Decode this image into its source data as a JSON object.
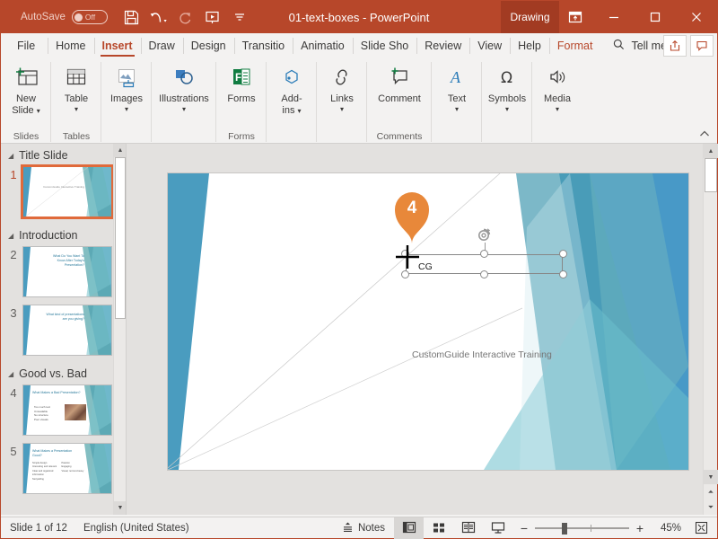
{
  "titlebar": {
    "autosave_label": "AutoSave",
    "autosave_state": "Off",
    "quick_access": [
      {
        "name": "save-icon",
        "tooltip": "Save"
      },
      {
        "name": "undo-icon",
        "tooltip": "Undo"
      },
      {
        "name": "redo-icon",
        "tooltip": "Redo"
      },
      {
        "name": "start-presentation-icon",
        "tooltip": "Start From Beginning"
      },
      {
        "name": "customize-qat-icon",
        "tooltip": "Customize Quick Access Toolbar"
      }
    ],
    "document_title": "01-text-boxes  -  PowerPoint",
    "contextual_tab": "Drawing",
    "ribbon_display_options": "ribbon-display-options-icon",
    "minimize": "minimize-icon",
    "maximize": "maximize-icon",
    "close": "close-icon"
  },
  "tabs": [
    {
      "label": "File",
      "active": false
    },
    {
      "label": "Home",
      "active": false
    },
    {
      "label": "Insert",
      "active": true
    },
    {
      "label": "Draw",
      "active": false
    },
    {
      "label": "Design",
      "active": false
    },
    {
      "label": "Transitio",
      "active": false
    },
    {
      "label": "Animatio",
      "active": false
    },
    {
      "label": "Slide Sho",
      "active": false
    },
    {
      "label": "Review",
      "active": false
    },
    {
      "label": "View",
      "active": false
    },
    {
      "label": "Help",
      "active": false
    },
    {
      "label": "Format",
      "active": false,
      "contextual": true
    }
  ],
  "tellme": {
    "icon": "search-icon",
    "label": "Tell me",
    "share_icon": "share-icon",
    "comments_icon": "comments-icon"
  },
  "ribbon": {
    "groups": [
      {
        "label": "Slides",
        "items": [
          {
            "label": "New\nSlide",
            "icon": "new-slide-icon",
            "dropdown": true,
            "inline_caret": true
          }
        ]
      },
      {
        "label": "Tables",
        "items": [
          {
            "label": "Table",
            "icon": "table-icon",
            "dropdown": true
          }
        ]
      },
      {
        "label": "",
        "items": [
          {
            "label": "Images",
            "icon": "images-icon",
            "dropdown": true
          }
        ]
      },
      {
        "label": "",
        "items": [
          {
            "label": "Illustrations",
            "icon": "illustrations-icon",
            "dropdown": true
          }
        ]
      },
      {
        "label": "Forms",
        "items": [
          {
            "label": "Forms",
            "icon": "forms-icon",
            "dropdown": false
          }
        ]
      },
      {
        "label": "",
        "items": [
          {
            "label": "Add-\nins",
            "icon": "add-ins-icon",
            "dropdown": true,
            "inline_caret": true
          }
        ]
      },
      {
        "label": "",
        "items": [
          {
            "label": "Links",
            "icon": "links-icon",
            "dropdown": true
          }
        ]
      },
      {
        "label": "Comments",
        "items": [
          {
            "label": "Comment",
            "icon": "comment-icon",
            "dropdown": false
          }
        ]
      },
      {
        "label": "",
        "items": [
          {
            "label": "Text",
            "icon": "text-icon",
            "dropdown": true
          }
        ]
      },
      {
        "label": "",
        "items": [
          {
            "label": "Symbols",
            "icon": "symbols-icon",
            "dropdown": true
          }
        ]
      },
      {
        "label": "",
        "items": [
          {
            "label": "Media",
            "icon": "media-icon",
            "dropdown": true
          }
        ]
      }
    ],
    "collapse_icon": "chevron-up-icon"
  },
  "thumbnails": {
    "sections": [
      {
        "title": "Title Slide",
        "slides": [
          {
            "number": "1",
            "selected": true,
            "type": "title",
            "lines": [
              "",
              "CustomGuide Interactive Training"
            ]
          }
        ]
      },
      {
        "title": "Introduction",
        "slides": [
          {
            "number": "2",
            "selected": false,
            "type": "text",
            "lines": [
              "What Do You Want To",
              "Know After Today's",
              "Presentation?"
            ]
          },
          {
            "number": "3",
            "selected": false,
            "type": "text",
            "lines": [
              "What kind of presentations",
              "are you giving?"
            ]
          }
        ]
      },
      {
        "title": "Good vs. Bad",
        "slides": [
          {
            "number": "4",
            "selected": false,
            "type": "bullets-photo",
            "lines": [
              "What Makes a Bad Presentation?"
            ],
            "bullets": [
              "Too much text",
              "Unreadable",
              "No structure",
              "Poor visuals"
            ]
          },
          {
            "number": "5",
            "selected": false,
            "type": "two-column",
            "lines": [
              "What Makes a Presentation Good?"
            ],
            "bullets_left": [
              "Simple design",
              "Interesting and relevant",
              "Clear and organized information",
              "Storytelling"
            ],
            "bullets_right": [
              "Passion",
              "Engaging",
              "Visual, not text-heavy"
            ]
          }
        ]
      }
    ],
    "scrollbar": {
      "up": "scroll-up-icon",
      "down": "scroll-down-icon"
    }
  },
  "slide": {
    "caption": "CustomGuide Interactive Training",
    "insertion": {
      "marker_number": "4",
      "cursor": "crosshair-cursor",
      "typed_text": "CG",
      "rotate_handle": "rotate-handle-icon"
    }
  },
  "canvas_scrollbar": {
    "up": "scroll-up-icon",
    "down": "scroll-down-icon",
    "previous_slide": "previous-slide-icon",
    "next_slide": "next-slide-icon"
  },
  "statusbar": {
    "slide_info": "Slide 1 of 12",
    "language": "English (United States)",
    "notes_label": "Notes",
    "notes_icon": "notes-icon",
    "views": [
      {
        "name": "normal-view",
        "icon": "normal-view-icon",
        "active": true
      },
      {
        "name": "slide-sorter-view",
        "icon": "slide-sorter-icon",
        "active": false
      },
      {
        "name": "reading-view",
        "icon": "reading-view-icon",
        "active": false
      },
      {
        "name": "slide-show-view",
        "icon": "slide-show-icon",
        "active": false
      }
    ],
    "zoom_out": "−",
    "zoom_in": "+",
    "zoom_level": "45%",
    "fit_slide_icon": "fit-to-window-icon"
  },
  "colors": {
    "title_bar": "#b7472a",
    "contextual_tab": "#a23b22",
    "accent_tab": "#b7472a",
    "selection_outline": "#e06a3b",
    "marker": "#e8883a",
    "slide_blue": "#4a9cbf",
    "slide_teal": "#5aa8ae",
    "ribbon_bg": "#f3f2f1",
    "pane_bg": "#e3e1df"
  }
}
